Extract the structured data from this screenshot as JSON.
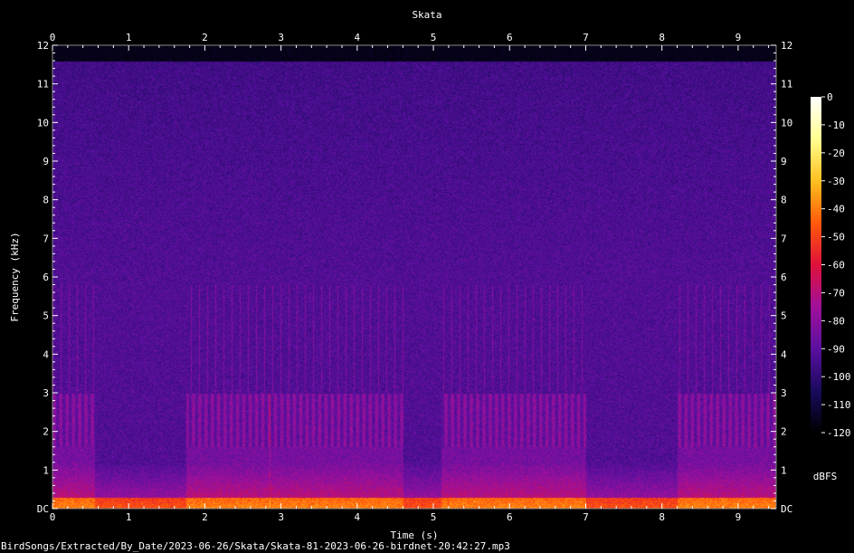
{
  "chart_data": {
    "type": "heatmap",
    "title": "Skata",
    "xlabel": "Time (s)",
    "ylabel": "Frequency (kHz)",
    "xlim": [
      0,
      9.5
    ],
    "ylim": [
      0,
      12
    ],
    "x_ticks": [
      "0",
      "1",
      "2",
      "3",
      "4",
      "5",
      "6",
      "7",
      "8",
      "9"
    ],
    "y_ticks": [
      "DC",
      "1",
      "2",
      "3",
      "4",
      "5",
      "6",
      "7",
      "8",
      "9",
      "10",
      "11",
      "12"
    ],
    "colorbar": {
      "label": "dBFS",
      "range": [
        -120,
        0
      ],
      "ticks": [
        "0",
        "-10",
        "-20",
        "-30",
        "-40",
        "-50",
        "-60",
        "-70",
        "-80",
        "-90",
        "-100",
        "-110",
        "-120"
      ],
      "colormap": [
        "#000000",
        "#1a0a5e",
        "#5a10a0",
        "#a0109a",
        "#e0103a",
        "#ff5a0a",
        "#ffc020",
        "#ffff90",
        "#ffffff"
      ]
    },
    "signal_cutoff_khz": 11.6,
    "call_segments_s": [
      [
        0,
        0.55
      ],
      [
        1.75,
        2.85
      ],
      [
        2.85,
        4.6
      ],
      [
        5.1,
        7.0
      ],
      [
        8.2,
        9.5
      ]
    ],
    "footer": "BirdSongs/Extracted/By_Date/2023-06-26/Skata/Skata-81-2023-06-26-birdnet-20:42:27.mp3"
  }
}
